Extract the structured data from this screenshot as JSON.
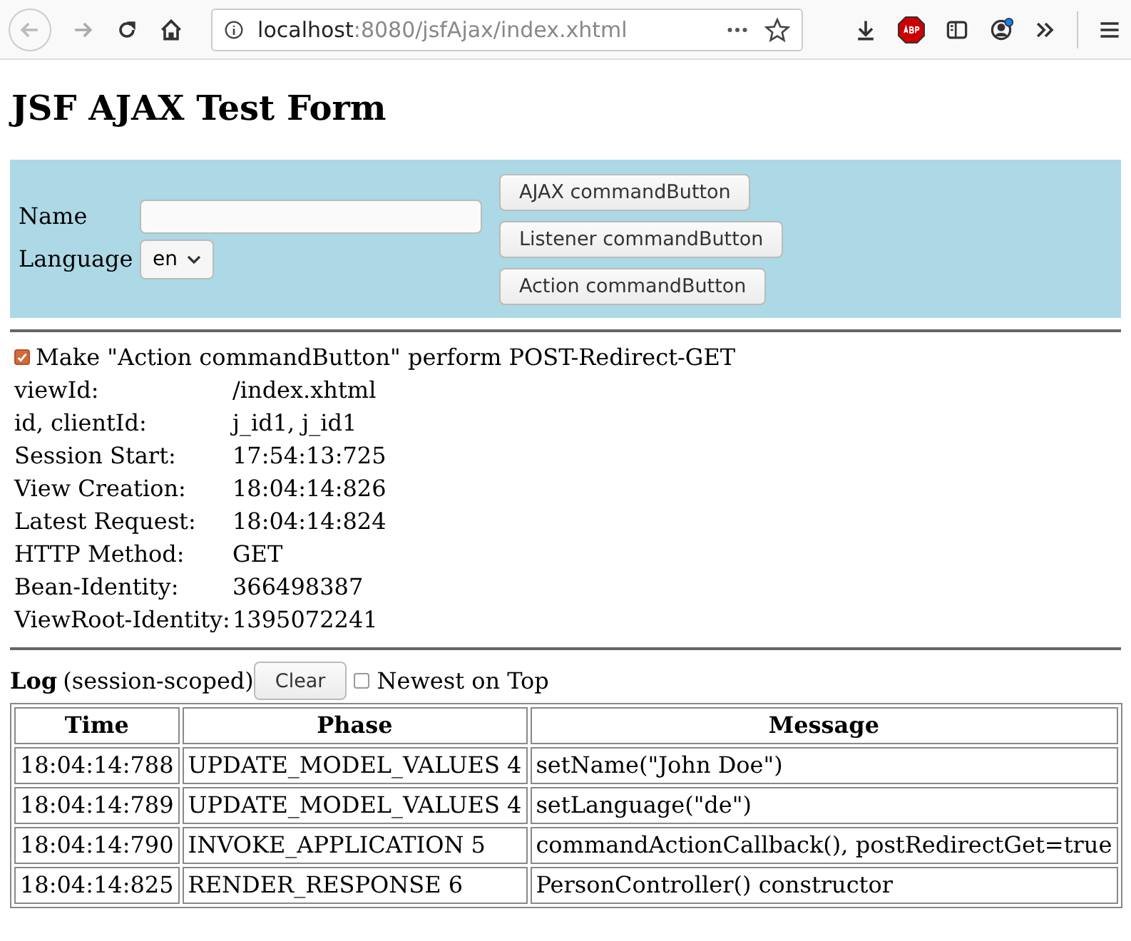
{
  "browser": {
    "url_host": "localhost",
    "url_path": ":8080/jsfAjax/index.xhtml",
    "forward_disabled": true
  },
  "title": "JSF AJAX Test Form",
  "form": {
    "name_label": "Name",
    "language_label": "Language",
    "language_value": "en",
    "buttons": [
      "AJAX commandButton",
      "Listener commandButton",
      "Action commandButton"
    ]
  },
  "prg": {
    "label": "Make \"Action commandButton\" perform POST-Redirect-GET",
    "checked": true
  },
  "info": [
    {
      "label": "viewId:",
      "value": "/index.xhtml"
    },
    {
      "label": "id, clientId:",
      "value": "j_id1, j_id1"
    },
    {
      "label": "Session Start:",
      "value": "17:54:13:725"
    },
    {
      "label": "View Creation:",
      "value": "18:04:14:826"
    },
    {
      "label": "Latest Request:",
      "value": "18:04:14:824"
    },
    {
      "label": "HTTP Method:",
      "value": "GET"
    },
    {
      "label": "Bean-Identity:",
      "value": "366498387"
    },
    {
      "label": "ViewRoot-Identity:",
      "value": "1395072241"
    }
  ],
  "log": {
    "title": "Log",
    "subtitle": "(session-scoped)",
    "clear_button": "Clear",
    "newest_on_top": {
      "label": "Newest on Top",
      "checked": false
    },
    "columns": [
      "Time",
      "Phase",
      "Message"
    ],
    "rows": [
      [
        "18:04:14:788",
        "UPDATE_MODEL_VALUES 4",
        "setName(\"John Doe\")"
      ],
      [
        "18:04:14:789",
        "UPDATE_MODEL_VALUES 4",
        "setLanguage(\"de\")"
      ],
      [
        "18:04:14:790",
        "INVOKE_APPLICATION 5",
        "commandActionCallback(), postRedirectGet=true"
      ],
      [
        "18:04:14:825",
        "RENDER_RESPONSE 6",
        "PersonController() constructor"
      ]
    ]
  }
}
